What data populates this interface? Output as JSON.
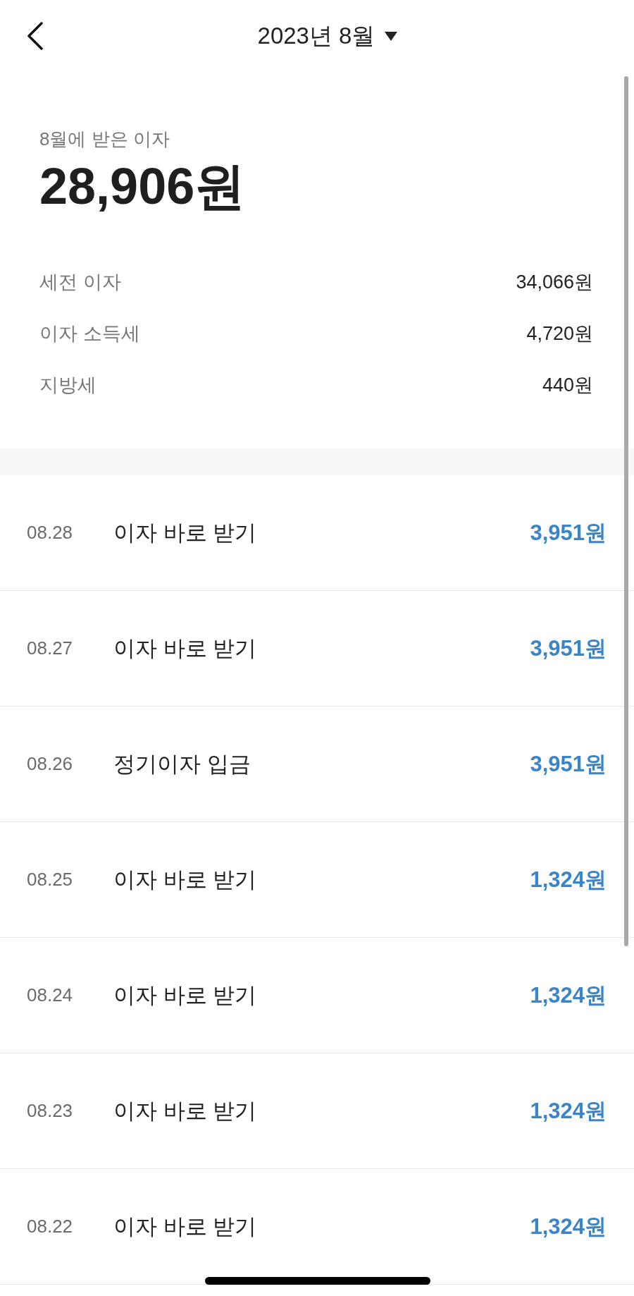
{
  "header": {
    "title": "2023년 8월"
  },
  "summary": {
    "label": "8월에 받은 이자",
    "total": "28,906원",
    "breakdown": [
      {
        "label": "세전 이자",
        "value": "34,066원"
      },
      {
        "label": "이자 소득세",
        "value": "4,720원"
      },
      {
        "label": "지방세",
        "value": "440원"
      }
    ]
  },
  "transactions": [
    {
      "date": "08.28",
      "description": "이자 바로 받기",
      "amount": "3,951원"
    },
    {
      "date": "08.27",
      "description": "이자 바로 받기",
      "amount": "3,951원"
    },
    {
      "date": "08.26",
      "description": "정기이자 입금",
      "amount": "3,951원"
    },
    {
      "date": "08.25",
      "description": "이자 바로 받기",
      "amount": "1,324원"
    },
    {
      "date": "08.24",
      "description": "이자 바로 받기",
      "amount": "1,324원"
    },
    {
      "date": "08.23",
      "description": "이자 바로 받기",
      "amount": "1,324원"
    },
    {
      "date": "08.22",
      "description": "이자 바로 받기",
      "amount": "1,324원"
    }
  ]
}
